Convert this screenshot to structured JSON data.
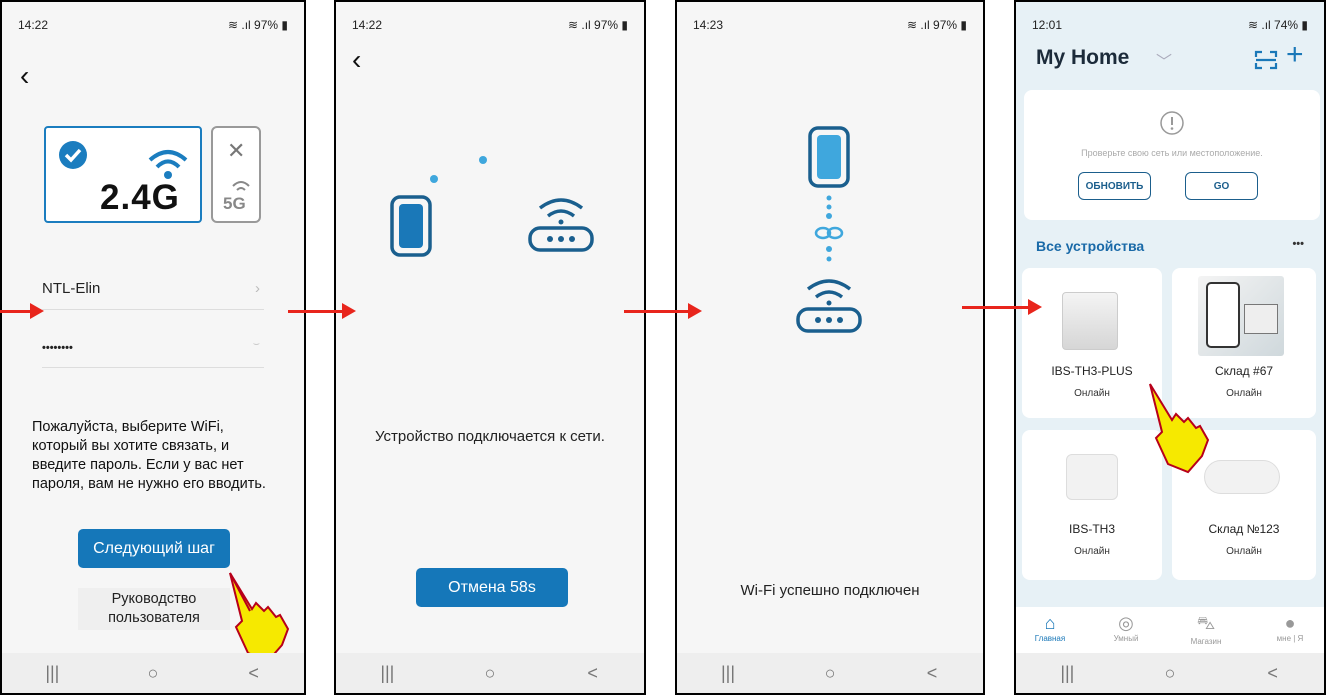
{
  "screen1": {
    "time": "14:22",
    "status_right": "97%",
    "band_24": "2.4G",
    "band_5": "5G",
    "ssid": "NTL-Elin",
    "password_masked": "••••••••",
    "instruction": "Пожалуйста, выберите WiFi, который вы хотите связать, и введите пароль. Если у вас нет пароля, вам не нужно его вводить.",
    "next_label": "Следующий шаг",
    "guide_label": "Руководство пользователя"
  },
  "screen2": {
    "time": "14:22",
    "status_right": "97%",
    "message": "Устройство подключается к сети.",
    "cancel_label": "Отмена  58s"
  },
  "screen3": {
    "time": "14:23",
    "status_right": "97%",
    "message": "Wi-Fi успешно подключен"
  },
  "screen4": {
    "time": "12:01",
    "status_right": "74%",
    "home_title": "My Home",
    "warning_text": "Проверьте свою сеть или местоположение.",
    "refresh_label": "ОБНОВИТЬ",
    "go_label": "GO",
    "section_title": "Все устройства",
    "more": "•••",
    "devices": [
      {
        "name": "IBS-TH3-PLUS",
        "status": "Онлайн"
      },
      {
        "name": "Склад #67",
        "status": "Онлайн"
      },
      {
        "name": "IBS-TH3",
        "status": "Онлайн"
      },
      {
        "name": "Склад №123",
        "status": "Онлайн"
      }
    ],
    "tabs": [
      "Главная",
      "Умный",
      "Магазин",
      "мне | Я"
    ]
  },
  "nav": {
    "recents": "|||",
    "home": "○",
    "back": "<"
  },
  "colors": {
    "accent": "#1577b9",
    "arrow": "#e8251c",
    "hand": "#f6e900"
  }
}
